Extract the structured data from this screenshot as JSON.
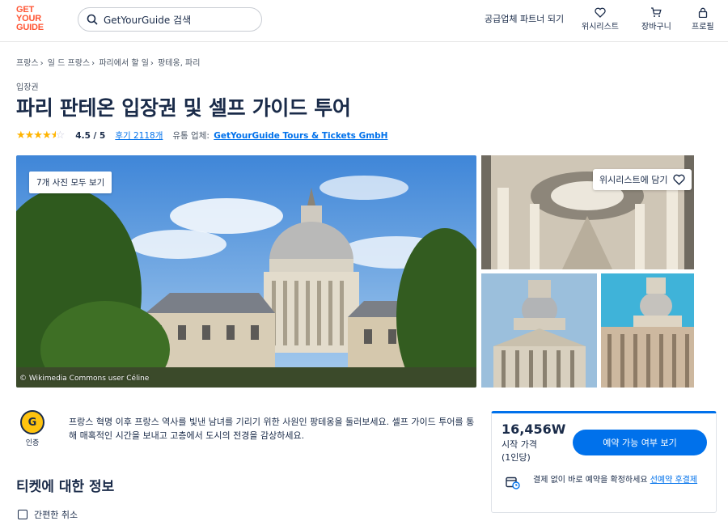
{
  "header": {
    "logo_lines": [
      "GET",
      "YOUR",
      "GUIDE"
    ],
    "search_placeholder": "GetYourGuide 검색",
    "partner_link": "공급업체 파트너 되기",
    "wishlist_label": "위시리스트",
    "cart_label": "장바구니",
    "profile_label": "프로필"
  },
  "breadcrumb": [
    "프랑스",
    "일 드 프랑스",
    "파리에서 할 일",
    "팡테옹, 파리"
  ],
  "category": "입장권",
  "title": "파리 판테온 입장권 및 셀프 가이드 투어",
  "rating": {
    "stars": 4.5,
    "score_text": "4.5 / 5",
    "reviews_text": "후기 2118개",
    "provider_label": "유통 업체:",
    "provider_name": "GetYourGuide Tours & Tickets GmbH"
  },
  "gallery": {
    "all_photos_button": "7개 사진 모두 보기",
    "wishlist_button": "위시리스트에 담기",
    "credit": "© Wikimedia Commons user Céline"
  },
  "badge": {
    "letter": "G",
    "label": "인증"
  },
  "description": "프랑스 혁명 이후 프랑스 역사를 빛낸 남녀를 기리기 위한 사원인 팡테옹을 둘러보세요. 셀프 가이드 투어를 통해 매혹적인 시간을 보내고 고층에서 도시의 전경을 감상하세요.",
  "section_title": "티켓에 대한 정보",
  "features": [
    {
      "label": "간편한 취소"
    }
  ],
  "booking": {
    "price": "16,456W",
    "price_label": "시작 가격",
    "per_person": "(1인당)",
    "availability_button": "예약 가능 여부 보기",
    "note_text": "결제 없이 바로 예약을 확정하세요 ",
    "note_link": "선예약 후결제"
  },
  "colors": {
    "brand": "#ff5533",
    "accent": "#0071eb",
    "text": "#1a2b49",
    "star": "#ffb400",
    "badge": "#ffc30f"
  }
}
